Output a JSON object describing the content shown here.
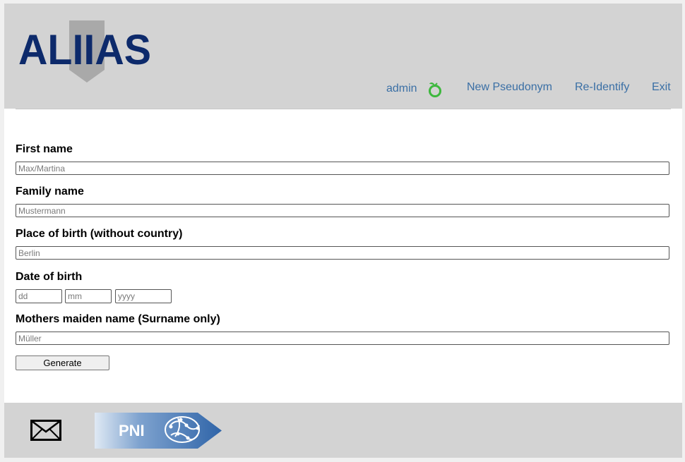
{
  "header": {
    "logo_text": "ALIIAS",
    "nav": {
      "user": "admin",
      "user_icon": "leaf-logout-icon",
      "new_pseudonym": "New Pseudonym",
      "re_identify": "Re-Identify",
      "exit": "Exit"
    }
  },
  "form": {
    "first_name": {
      "label": "First name",
      "placeholder": "Max/Martina"
    },
    "family_name": {
      "label": "Family name",
      "placeholder": "Mustermann"
    },
    "place_of_birth": {
      "label": "Place of birth (without country)",
      "placeholder": "Berlin"
    },
    "date_of_birth": {
      "label": "Date of birth",
      "day_placeholder": "dd",
      "month_placeholder": "mm",
      "year_placeholder": "yyyy"
    },
    "mothers_maiden_name": {
      "label": "Mothers maiden name (Surname only)",
      "placeholder": "Müller"
    },
    "generate_label": "Generate"
  },
  "footer": {
    "mail_icon": "envelope-icon",
    "partner_logo_text": "PNI"
  },
  "colors": {
    "header_bg": "#d3d3d3",
    "nav_link": "#3a6fa5",
    "logo_navy": "#0d2a6b",
    "leaf_green": "#3db83d"
  }
}
